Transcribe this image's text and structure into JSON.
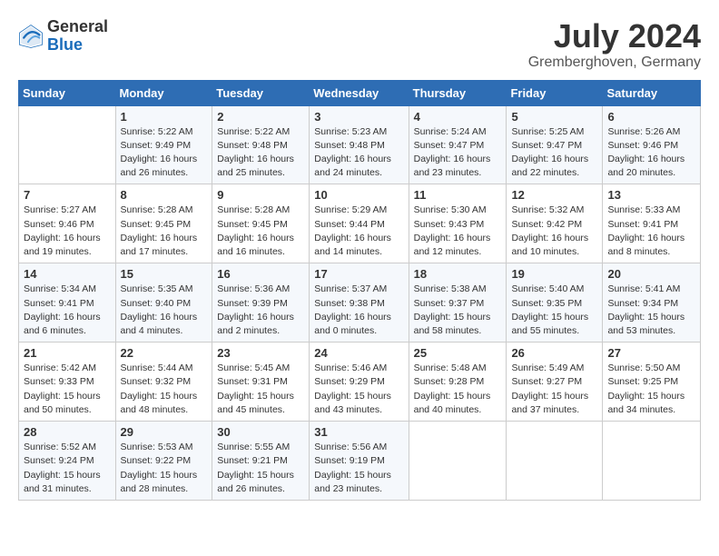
{
  "header": {
    "logo_general": "General",
    "logo_blue": "Blue",
    "month_year": "July 2024",
    "location": "Gremberghoven, Germany"
  },
  "days_of_week": [
    "Sunday",
    "Monday",
    "Tuesday",
    "Wednesday",
    "Thursday",
    "Friday",
    "Saturday"
  ],
  "weeks": [
    [
      {
        "day": "",
        "info": ""
      },
      {
        "day": "1",
        "info": "Sunrise: 5:22 AM\nSunset: 9:49 PM\nDaylight: 16 hours\nand 26 minutes."
      },
      {
        "day": "2",
        "info": "Sunrise: 5:22 AM\nSunset: 9:48 PM\nDaylight: 16 hours\nand 25 minutes."
      },
      {
        "day": "3",
        "info": "Sunrise: 5:23 AM\nSunset: 9:48 PM\nDaylight: 16 hours\nand 24 minutes."
      },
      {
        "day": "4",
        "info": "Sunrise: 5:24 AM\nSunset: 9:47 PM\nDaylight: 16 hours\nand 23 minutes."
      },
      {
        "day": "5",
        "info": "Sunrise: 5:25 AM\nSunset: 9:47 PM\nDaylight: 16 hours\nand 22 minutes."
      },
      {
        "day": "6",
        "info": "Sunrise: 5:26 AM\nSunset: 9:46 PM\nDaylight: 16 hours\nand 20 minutes."
      }
    ],
    [
      {
        "day": "7",
        "info": "Sunrise: 5:27 AM\nSunset: 9:46 PM\nDaylight: 16 hours\nand 19 minutes."
      },
      {
        "day": "8",
        "info": "Sunrise: 5:28 AM\nSunset: 9:45 PM\nDaylight: 16 hours\nand 17 minutes."
      },
      {
        "day": "9",
        "info": "Sunrise: 5:28 AM\nSunset: 9:45 PM\nDaylight: 16 hours\nand 16 minutes."
      },
      {
        "day": "10",
        "info": "Sunrise: 5:29 AM\nSunset: 9:44 PM\nDaylight: 16 hours\nand 14 minutes."
      },
      {
        "day": "11",
        "info": "Sunrise: 5:30 AM\nSunset: 9:43 PM\nDaylight: 16 hours\nand 12 minutes."
      },
      {
        "day": "12",
        "info": "Sunrise: 5:32 AM\nSunset: 9:42 PM\nDaylight: 16 hours\nand 10 minutes."
      },
      {
        "day": "13",
        "info": "Sunrise: 5:33 AM\nSunset: 9:41 PM\nDaylight: 16 hours\nand 8 minutes."
      }
    ],
    [
      {
        "day": "14",
        "info": "Sunrise: 5:34 AM\nSunset: 9:41 PM\nDaylight: 16 hours\nand 6 minutes."
      },
      {
        "day": "15",
        "info": "Sunrise: 5:35 AM\nSunset: 9:40 PM\nDaylight: 16 hours\nand 4 minutes."
      },
      {
        "day": "16",
        "info": "Sunrise: 5:36 AM\nSunset: 9:39 PM\nDaylight: 16 hours\nand 2 minutes."
      },
      {
        "day": "17",
        "info": "Sunrise: 5:37 AM\nSunset: 9:38 PM\nDaylight: 16 hours\nand 0 minutes."
      },
      {
        "day": "18",
        "info": "Sunrise: 5:38 AM\nSunset: 9:37 PM\nDaylight: 15 hours\nand 58 minutes."
      },
      {
        "day": "19",
        "info": "Sunrise: 5:40 AM\nSunset: 9:35 PM\nDaylight: 15 hours\nand 55 minutes."
      },
      {
        "day": "20",
        "info": "Sunrise: 5:41 AM\nSunset: 9:34 PM\nDaylight: 15 hours\nand 53 minutes."
      }
    ],
    [
      {
        "day": "21",
        "info": "Sunrise: 5:42 AM\nSunset: 9:33 PM\nDaylight: 15 hours\nand 50 minutes."
      },
      {
        "day": "22",
        "info": "Sunrise: 5:44 AM\nSunset: 9:32 PM\nDaylight: 15 hours\nand 48 minutes."
      },
      {
        "day": "23",
        "info": "Sunrise: 5:45 AM\nSunset: 9:31 PM\nDaylight: 15 hours\nand 45 minutes."
      },
      {
        "day": "24",
        "info": "Sunrise: 5:46 AM\nSunset: 9:29 PM\nDaylight: 15 hours\nand 43 minutes."
      },
      {
        "day": "25",
        "info": "Sunrise: 5:48 AM\nSunset: 9:28 PM\nDaylight: 15 hours\nand 40 minutes."
      },
      {
        "day": "26",
        "info": "Sunrise: 5:49 AM\nSunset: 9:27 PM\nDaylight: 15 hours\nand 37 minutes."
      },
      {
        "day": "27",
        "info": "Sunrise: 5:50 AM\nSunset: 9:25 PM\nDaylight: 15 hours\nand 34 minutes."
      }
    ],
    [
      {
        "day": "28",
        "info": "Sunrise: 5:52 AM\nSunset: 9:24 PM\nDaylight: 15 hours\nand 31 minutes."
      },
      {
        "day": "29",
        "info": "Sunrise: 5:53 AM\nSunset: 9:22 PM\nDaylight: 15 hours\nand 28 minutes."
      },
      {
        "day": "30",
        "info": "Sunrise: 5:55 AM\nSunset: 9:21 PM\nDaylight: 15 hours\nand 26 minutes."
      },
      {
        "day": "31",
        "info": "Sunrise: 5:56 AM\nSunset: 9:19 PM\nDaylight: 15 hours\nand 23 minutes."
      },
      {
        "day": "",
        "info": ""
      },
      {
        "day": "",
        "info": ""
      },
      {
        "day": "",
        "info": ""
      }
    ]
  ]
}
